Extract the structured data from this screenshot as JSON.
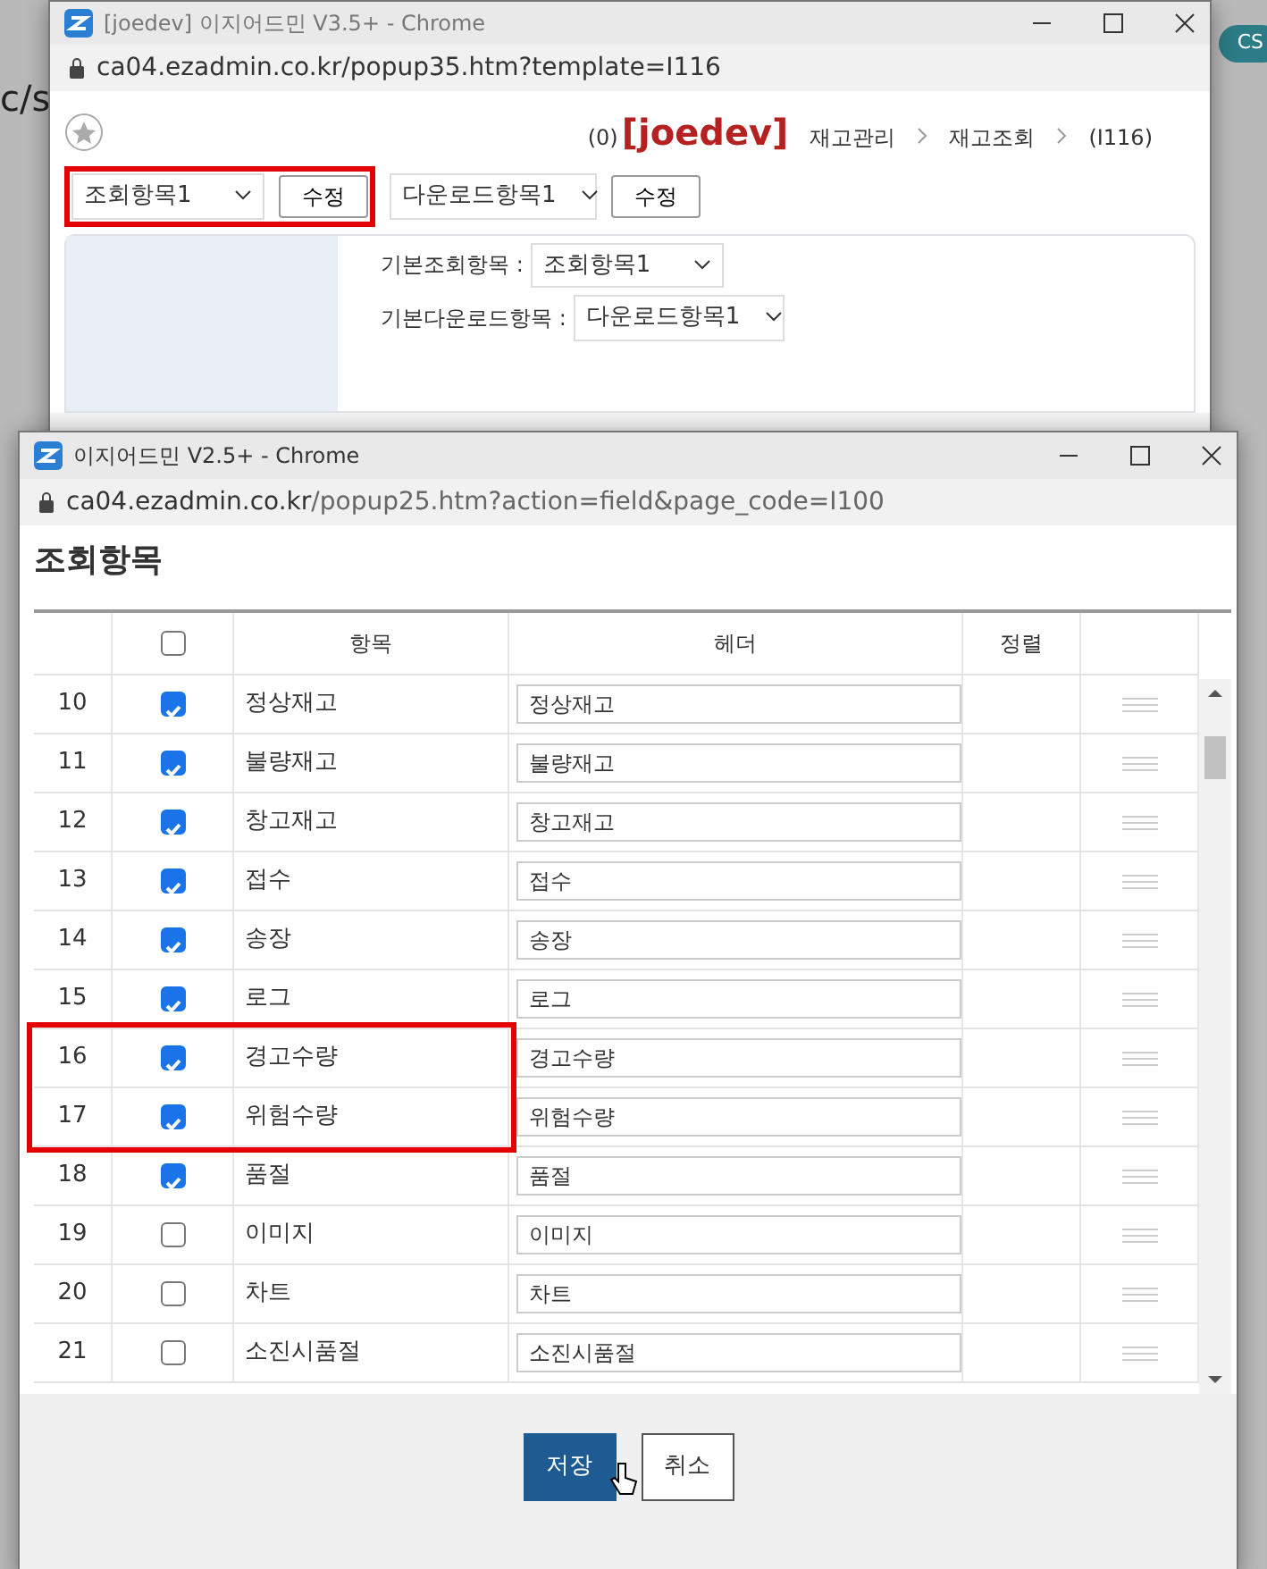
{
  "background_page": {
    "fragment": "c/s",
    "badge": "CS"
  },
  "back_window": {
    "title": "[joedev] 이지어드민 V3.5+ - Chrome",
    "url": "ca04.ezadmin.co.kr/popup35.htm?template=I116",
    "count": "(0)",
    "user": "[joedev]",
    "breadcrumb": [
      "재고관리",
      "재고조회",
      "(I116)"
    ],
    "view_select": "조회항목1",
    "view_edit": "수정",
    "view_highlighted": true,
    "download_select": "다운로드항목1",
    "download_edit": "수정",
    "default_view_label": "기본조회항목 :",
    "default_view_select": "조회항목1",
    "default_download_label": "기본다운로드항목 :",
    "default_download_select": "다운로드항목1"
  },
  "front_window": {
    "title": "이지어드민 V2.5+ - Chrome",
    "url_host": "ca04.ezadmin.co.kr",
    "url_path": "/popup25.htm?action=field&page_code=I100",
    "heading": "조회항목",
    "table": {
      "header_checkbox": {
        "checked": false
      },
      "columns": [
        "항목",
        "헤더",
        "정렬"
      ],
      "rows": [
        {
          "no": "10",
          "checked": true,
          "name": "정상재고",
          "header": "정상재고",
          "highlighted": false
        },
        {
          "no": "11",
          "checked": true,
          "name": "불량재고",
          "header": "불량재고",
          "highlighted": false
        },
        {
          "no": "12",
          "checked": true,
          "name": "창고재고",
          "header": "창고재고",
          "highlighted": false
        },
        {
          "no": "13",
          "checked": true,
          "name": "접수",
          "header": "접수",
          "highlighted": false
        },
        {
          "no": "14",
          "checked": true,
          "name": "송장",
          "header": "송장",
          "highlighted": false
        },
        {
          "no": "15",
          "checked": true,
          "name": "로그",
          "header": "로그",
          "highlighted": false
        },
        {
          "no": "16",
          "checked": true,
          "name": "경고수량",
          "header": "경고수량",
          "highlighted": true
        },
        {
          "no": "17",
          "checked": true,
          "name": "위험수량",
          "header": "위험수량",
          "highlighted": true
        },
        {
          "no": "18",
          "checked": true,
          "name": "품절",
          "header": "품절",
          "highlighted": false
        },
        {
          "no": "19",
          "checked": false,
          "name": "이미지",
          "header": "이미지",
          "highlighted": false
        },
        {
          "no": "20",
          "checked": false,
          "name": "차트",
          "header": "차트",
          "highlighted": false
        },
        {
          "no": "21",
          "checked": false,
          "name": "소진시품절",
          "header": "소진시품절",
          "highlighted": false
        }
      ]
    },
    "buttons": [
      {
        "kind": "primary",
        "label": "저장"
      },
      {
        "kind": "secondary",
        "label": "취소"
      }
    ]
  }
}
